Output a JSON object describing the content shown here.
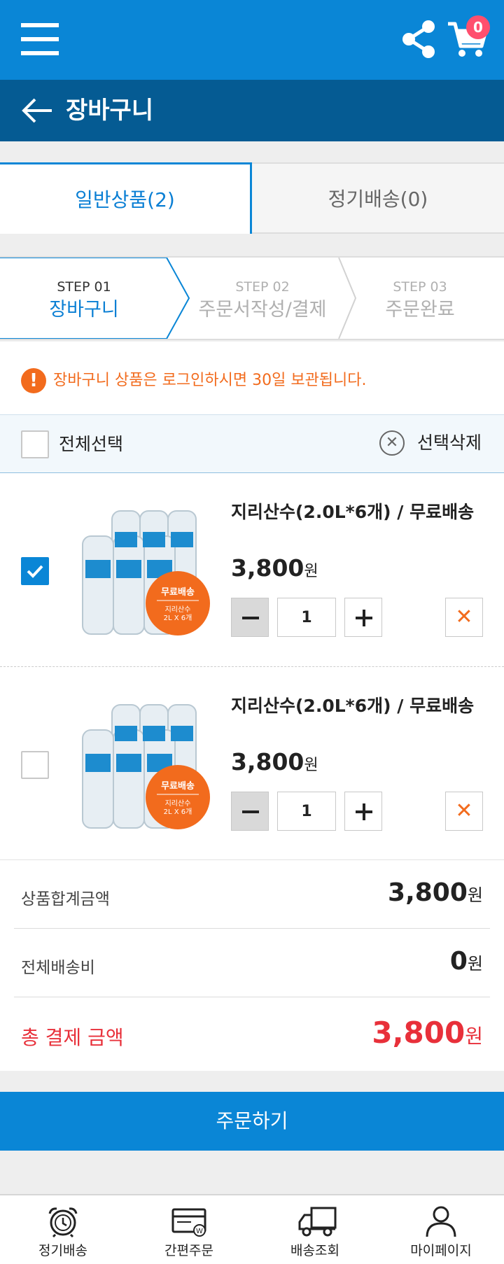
{
  "header": {
    "menu_icon": "hamburger-icon",
    "share_icon": "share-icon",
    "cart_icon": "cart-icon",
    "cart_count": "0",
    "back_icon": "arrow-left-icon",
    "title": "장바구니"
  },
  "tabs": [
    {
      "label": "일반상품(2)",
      "active": true
    },
    {
      "label": "정기배송(0)",
      "active": false
    }
  ],
  "steps": [
    {
      "num": "STEP 01",
      "label": "장바구니",
      "active": true
    },
    {
      "num": "STEP 02",
      "label": "주문서작성/결제",
      "active": false
    },
    {
      "num": "STEP 03",
      "label": "주문완료",
      "active": false
    }
  ],
  "notice": {
    "icon": "exclamation-icon",
    "text": "장바구니 상품은 로그인하시면 30일 보관됩니다."
  },
  "selection": {
    "select_all_label": "전체선택",
    "select_all_checked": false,
    "delete_selected_label": "선택삭제"
  },
  "items": [
    {
      "name": "지리산수(2.0L*6개) / 무료배송",
      "price": "3,800",
      "currency": "원",
      "quantity": "1",
      "checked": true,
      "badge_title": "무료배송",
      "badge_line1": "지리산수",
      "badge_line2": "2L X 6개"
    },
    {
      "name": "지리산수(2.0L*6개) / 무료배송",
      "price": "3,800",
      "currency": "원",
      "quantity": "1",
      "checked": false,
      "badge_title": "무료배송",
      "badge_line1": "지리산수",
      "badge_line2": "2L X 6개"
    }
  ],
  "summary": {
    "subtotal_label": "상품합계금액",
    "subtotal_value": "3,800",
    "shipping_label": "전체배송비",
    "shipping_value": "0",
    "total_label": "총 결제 금액",
    "total_value": "3,800",
    "currency": "원"
  },
  "order_button": "주문하기",
  "bottom_nav": [
    {
      "label": "정기배송",
      "icon": "alarm-clock-icon"
    },
    {
      "label": "간편주문",
      "icon": "card-icon"
    },
    {
      "label": "배송조회",
      "icon": "truck-icon"
    },
    {
      "label": "마이페이지",
      "icon": "user-icon"
    }
  ],
  "colors": {
    "primary": "#0a86d6",
    "title_bar": "#055b93",
    "accent_orange": "#f26b1d",
    "total_red": "#e8303a",
    "badge_pink": "#ff4f6e"
  }
}
